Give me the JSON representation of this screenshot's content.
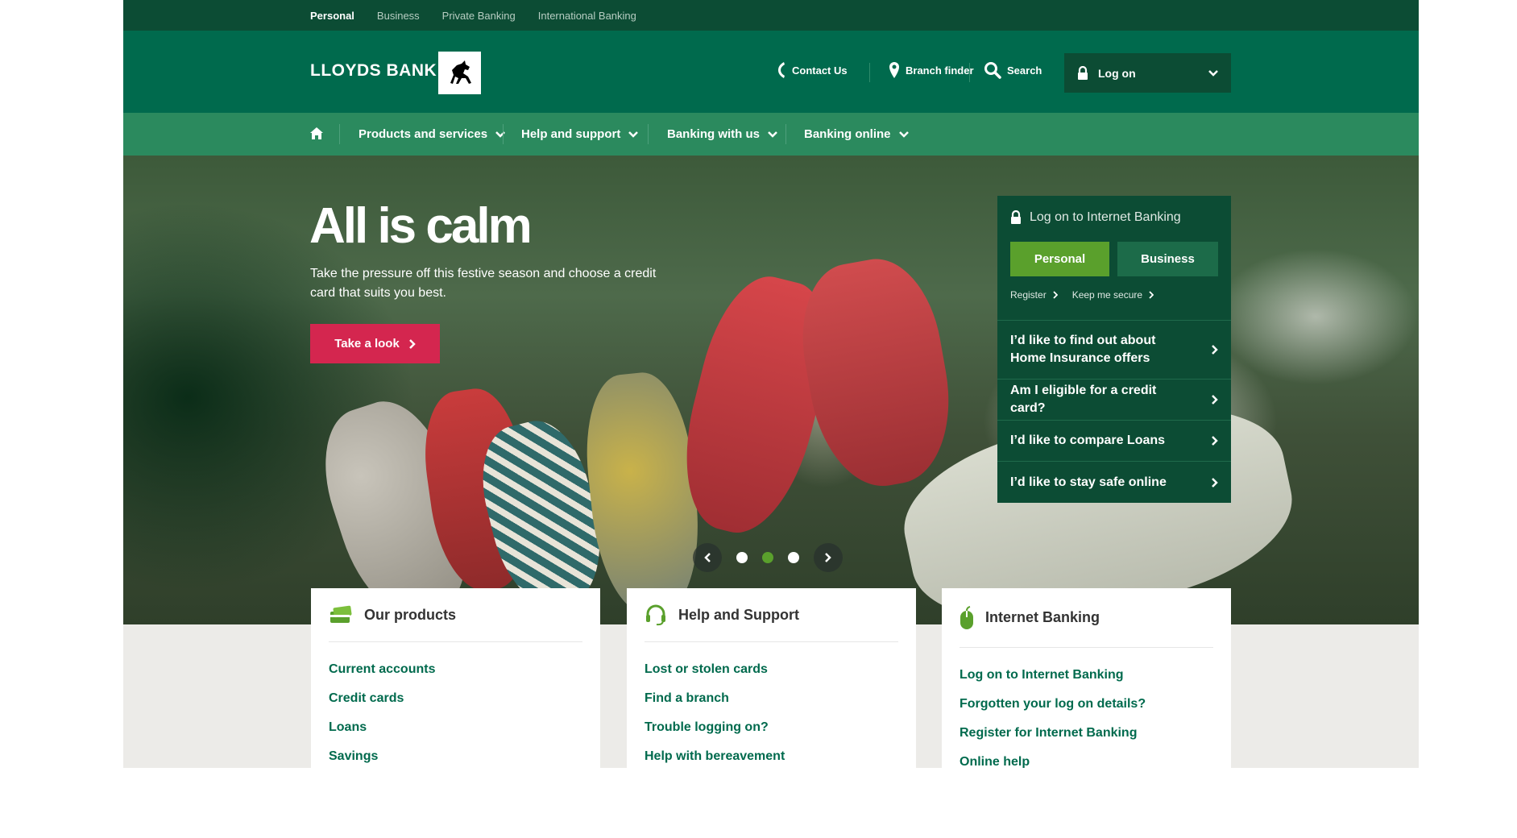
{
  "topbar": {
    "items": [
      {
        "label": "Personal",
        "active": true
      },
      {
        "label": "Business"
      },
      {
        "label": "Private Banking"
      },
      {
        "label": "International Banking"
      }
    ]
  },
  "header": {
    "brand": "LLOYDS BANK",
    "logo_icon": "black-horse-logo",
    "contact_label": "Contact Us",
    "branch_label": "Branch finder",
    "search_label": "Search",
    "logon_label": "Log on"
  },
  "nav": {
    "items": [
      {
        "label": "Products and services"
      },
      {
        "label": "Help and support"
      },
      {
        "label": "Banking with us"
      },
      {
        "label": "Banking online"
      }
    ]
  },
  "hero": {
    "title": "All is calm",
    "subtitle": "Take the pressure off this festive season and choose a credit card that suits you best.",
    "cta": "Take a look",
    "slides_total": 3,
    "active_slide": 2
  },
  "panel": {
    "title": "Log on to Internet Banking",
    "personal": "Personal",
    "business": "Business",
    "register": "Register",
    "keep_secure": "Keep me secure",
    "questions": [
      {
        "label": "I’d like to find out about Home Insurance offers"
      },
      {
        "label": "Am I eligible for a credit card?"
      },
      {
        "label": "I’d like to compare Loans"
      },
      {
        "label": "I’d like to stay safe online"
      }
    ]
  },
  "cards": [
    {
      "title": "Our products",
      "icon": "cards-icon",
      "links": [
        "Current accounts",
        "Credit cards",
        "Loans",
        "Savings"
      ]
    },
    {
      "title": "Help and Support",
      "icon": "headset-icon",
      "links": [
        "Lost or stolen cards",
        "Find a branch",
        "Trouble logging on?",
        "Help with bereavement"
      ]
    },
    {
      "title": "Internet Banking",
      "icon": "mouse-icon",
      "links": [
        "Log on to Internet Banking",
        "Forgotten your log on details?",
        "Register for Internet Banking",
        "Online help"
      ]
    }
  ],
  "colors": {
    "dark_green": "#0c4c34",
    "brand_green": "#006a4d",
    "nav_green": "#2b8a5e",
    "accent_green": "#5aa02c",
    "cta_pink": "#d4264f"
  }
}
